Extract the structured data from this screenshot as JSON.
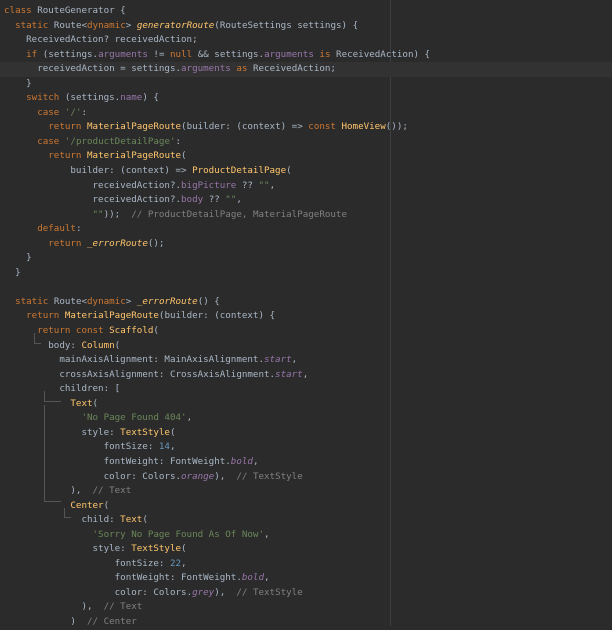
{
  "editor": {
    "lines": [
      [
        [
          "k",
          "class "
        ],
        [
          "t",
          "RouteGenerator {"
        ]
      ],
      [
        [
          "t",
          "  "
        ],
        [
          "k",
          "static "
        ],
        [
          "t",
          "Route<"
        ],
        [
          "k",
          "dynamic"
        ],
        [
          "t",
          "> "
        ],
        [
          "fn",
          "generatorRoute"
        ],
        [
          "t",
          "(RouteSettings settings) {"
        ]
      ],
      [
        [
          "t",
          "    ReceivedAction? receivedAction;"
        ]
      ],
      [
        [
          "t",
          "    "
        ],
        [
          "k",
          "if "
        ],
        [
          "t",
          "(settings."
        ],
        [
          "f",
          "arguments"
        ],
        [
          "t",
          " != "
        ],
        [
          "k",
          "null"
        ],
        [
          "t",
          " && settings."
        ],
        [
          "f",
          "arguments"
        ],
        [
          "t",
          " "
        ],
        [
          "k",
          "is"
        ],
        [
          "t",
          " ReceivedAction) {"
        ]
      ],
      [
        [
          "t",
          "      receivedAction = settings."
        ],
        [
          "f",
          "arguments"
        ],
        [
          "t",
          " "
        ],
        [
          "k",
          "as"
        ],
        [
          "t",
          " ReceivedAction;"
        ]
      ],
      [
        [
          "t",
          "    }"
        ]
      ],
      [
        [
          "t",
          "    "
        ],
        [
          "k",
          "switch "
        ],
        [
          "t",
          "(settings."
        ],
        [
          "f",
          "name"
        ],
        [
          "t",
          ") {"
        ]
      ],
      [
        [
          "t",
          "      "
        ],
        [
          "k",
          "case "
        ],
        [
          "s",
          "'/'"
        ],
        [
          "t",
          ":"
        ]
      ],
      [
        [
          "t",
          "        "
        ],
        [
          "k",
          "return "
        ],
        [
          "fb",
          "MaterialPageRoute"
        ],
        [
          "t",
          "(builder: (context) => "
        ],
        [
          "k",
          "const "
        ],
        [
          "fb",
          "HomeView"
        ],
        [
          "t",
          "());"
        ]
      ],
      [
        [
          "t",
          "      "
        ],
        [
          "k",
          "case "
        ],
        [
          "s",
          "'/productDetailPage'"
        ],
        [
          "t",
          ":"
        ]
      ],
      [
        [
          "t",
          "        "
        ],
        [
          "k",
          "return "
        ],
        [
          "fb",
          "MaterialPageRoute"
        ],
        [
          "t",
          "("
        ]
      ],
      [
        [
          "t",
          "            builder: (context) => "
        ],
        [
          "fb",
          "ProductDetailPage"
        ],
        [
          "t",
          "("
        ]
      ],
      [
        [
          "t",
          "                receivedAction?."
        ],
        [
          "f",
          "bigPicture"
        ],
        [
          "t",
          " ?? "
        ],
        [
          "s",
          "\"\""
        ],
        [
          "t",
          ","
        ]
      ],
      [
        [
          "t",
          "                receivedAction?."
        ],
        [
          "f",
          "body"
        ],
        [
          "t",
          " ?? "
        ],
        [
          "s",
          "\"\""
        ],
        [
          "t",
          ","
        ]
      ],
      [
        [
          "t",
          "                "
        ],
        [
          "s",
          "\"\""
        ],
        [
          "t",
          "));  "
        ],
        [
          "c",
          "// ProductDetailPage, MaterialPageRoute"
        ]
      ],
      [
        [
          "t",
          "      "
        ],
        [
          "k",
          "default"
        ],
        [
          "t",
          ":"
        ]
      ],
      [
        [
          "t",
          "        "
        ],
        [
          "k",
          "return "
        ],
        [
          "fn",
          "_errorRoute"
        ],
        [
          "t",
          "();"
        ]
      ],
      [
        [
          "t",
          "    }"
        ]
      ],
      [
        [
          "t",
          "  }"
        ]
      ],
      [],
      [
        [
          "t",
          "  "
        ],
        [
          "k",
          "static "
        ],
        [
          "t",
          "Route<"
        ],
        [
          "k",
          "dynamic"
        ],
        [
          "t",
          "> "
        ],
        [
          "fn",
          "_errorRoute"
        ],
        [
          "t",
          "() {"
        ]
      ],
      [
        [
          "t",
          "    "
        ],
        [
          "k",
          "return "
        ],
        [
          "fb",
          "MaterialPageRoute"
        ],
        [
          "t",
          "(builder: (context) {"
        ]
      ],
      [
        [
          "t",
          "      "
        ],
        [
          "k",
          "return const "
        ],
        [
          "fb",
          "Scaffold"
        ],
        [
          "t",
          "("
        ]
      ],
      [
        [
          "t",
          "        body: "
        ],
        [
          "fb",
          "Column"
        ],
        [
          "t",
          "("
        ]
      ],
      [
        [
          "t",
          "          mainAxisAlignment: MainAxisAlignment."
        ],
        [
          "fi",
          "start"
        ],
        [
          "t",
          ","
        ]
      ],
      [
        [
          "t",
          "          crossAxisAlignment: CrossAxisAlignment."
        ],
        [
          "fi",
          "start"
        ],
        [
          "t",
          ","
        ]
      ],
      [
        [
          "t",
          "          children: ["
        ]
      ],
      [
        [
          "t",
          "            "
        ],
        [
          "fb",
          "Text"
        ],
        [
          "t",
          "("
        ]
      ],
      [
        [
          "t",
          "              "
        ],
        [
          "s",
          "'No Page Found 404'"
        ],
        [
          "t",
          ","
        ]
      ],
      [
        [
          "t",
          "              style: "
        ],
        [
          "fb",
          "TextStyle"
        ],
        [
          "t",
          "("
        ]
      ],
      [
        [
          "t",
          "                  fontSize: "
        ],
        [
          "n",
          "14"
        ],
        [
          "t",
          ","
        ]
      ],
      [
        [
          "t",
          "                  fontWeight: FontWeight."
        ],
        [
          "fi",
          "bold"
        ],
        [
          "t",
          ","
        ]
      ],
      [
        [
          "t",
          "                  color: Colors."
        ],
        [
          "fi",
          "orange"
        ],
        [
          "t",
          "),  "
        ],
        [
          "c",
          "// TextStyle"
        ]
      ],
      [
        [
          "t",
          "            ),  "
        ],
        [
          "c",
          "// Text"
        ]
      ],
      [
        [
          "t",
          "            "
        ],
        [
          "fb",
          "Center"
        ],
        [
          "t",
          "("
        ]
      ],
      [
        [
          "t",
          "              child: "
        ],
        [
          "fb",
          "Text"
        ],
        [
          "t",
          "("
        ]
      ],
      [
        [
          "t",
          "                "
        ],
        [
          "s",
          "'Sorry No Page Found As Of Now'"
        ],
        [
          "t",
          ","
        ]
      ],
      [
        [
          "t",
          "                style: "
        ],
        [
          "fb",
          "TextStyle"
        ],
        [
          "t",
          "("
        ]
      ],
      [
        [
          "t",
          "                    fontSize: "
        ],
        [
          "n",
          "22"
        ],
        [
          "t",
          ","
        ]
      ],
      [
        [
          "t",
          "                    fontWeight: FontWeight."
        ],
        [
          "fi",
          "bold"
        ],
        [
          "t",
          ","
        ]
      ],
      [
        [
          "t",
          "                    color: Colors."
        ],
        [
          "fi",
          "grey"
        ],
        [
          "t",
          "),  "
        ],
        [
          "c",
          "// TextStyle"
        ]
      ],
      [
        [
          "t",
          "              ),  "
        ],
        [
          "c",
          "// Text"
        ]
      ],
      [
        [
          "t",
          "            )  "
        ],
        [
          "c",
          "// Center"
        ]
      ]
    ],
    "current_line": 4,
    "gutter_icon": "lightbulb-icon"
  }
}
